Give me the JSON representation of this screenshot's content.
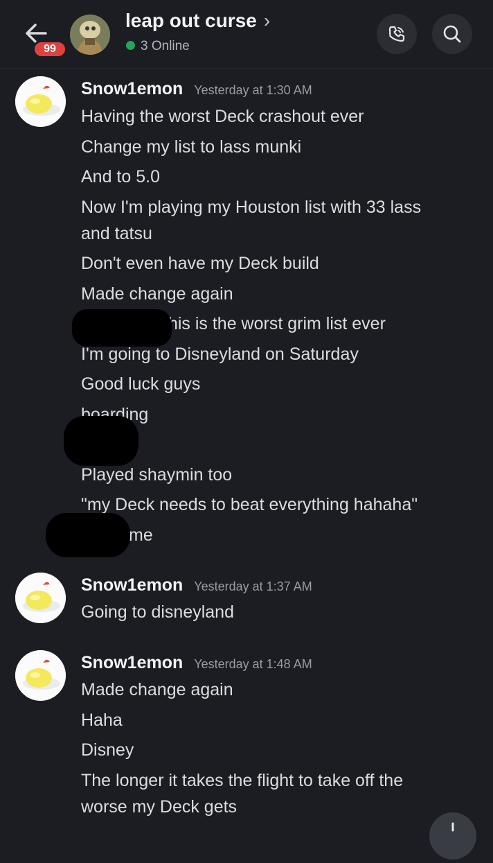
{
  "header": {
    "unread_badge": "99",
    "channel_title": "leap out curse",
    "title_chevron": "›",
    "online_text": "3 Online"
  },
  "groups": [
    {
      "username": "Snow1emon",
      "timestamp": "Yesterday at 1:30 AM",
      "lines": [
        "Having the worst Deck crashout ever",
        "Change my list to lass munki",
        "And to 5.0",
        "Now I'm playing my Houston list with 33 lass",
        "and tatsu",
        "Don't even have my Deck build",
        "Made change again",
        "this is the worst grim list ever",
        "I'm going to Disneyland on Saturday",
        "Good luck guys",
        "boarding",
        "Played shaymin too",
        "\"my Deck needs to beat everything hahaha\"",
        "me"
      ]
    },
    {
      "username": "Snow1emon",
      "timestamp": "Yesterday at 1:37 AM",
      "lines": [
        "Going to disneyland"
      ]
    },
    {
      "username": "Snow1emon",
      "timestamp": "Yesterday at 1:48 AM",
      "lines": [
        "Made change again",
        "Haha",
        "Disney",
        "The longer it takes the flight to take off the",
        "worse my Deck gets"
      ]
    }
  ],
  "icons": {
    "back": "arrow-left-icon",
    "call": "phone-call-icon",
    "search": "search-icon",
    "scroll_down": "chevron-down-icon"
  },
  "colors": {
    "background": "#1c1d22",
    "badge": "#e0413f",
    "online": "#23a55a",
    "username": "#f2f3f5",
    "timestamp": "#9a9ca3",
    "text": "#dcdde0"
  }
}
